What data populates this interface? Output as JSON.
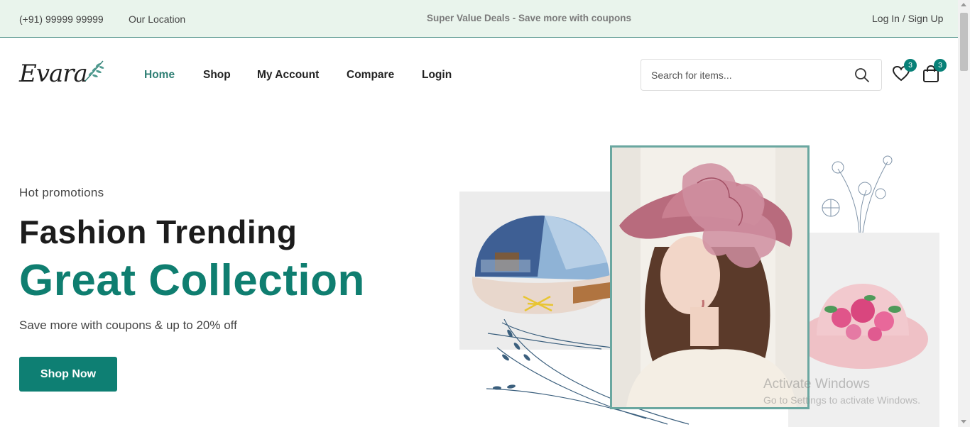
{
  "topbar": {
    "phone": "(+91) 99999 99999",
    "location": "Our Location",
    "deal": "Super Value Deals - Save more with coupons",
    "auth": "Log In / Sign Up"
  },
  "header": {
    "logo": "Evara",
    "nav": [
      "Home",
      "Shop",
      "My Account",
      "Compare",
      "Login"
    ],
    "active_nav": "Home",
    "search_placeholder": "Search for items...",
    "wishlist_count": "3",
    "cart_count": "3"
  },
  "hero": {
    "eyebrow": "Hot promotions",
    "title": "Fashion Trending",
    "highlight": "Great Collection",
    "subtitle": "Save more with coupons & up to 20% off",
    "cta": "Shop Now"
  },
  "watermark": {
    "line1": "Activate Windows",
    "line2": "Go to Settings to activate Windows."
  },
  "colors": {
    "accent": "#088178",
    "topbar_bg": "#e9f4ec",
    "heading": "#1c1c1c"
  }
}
